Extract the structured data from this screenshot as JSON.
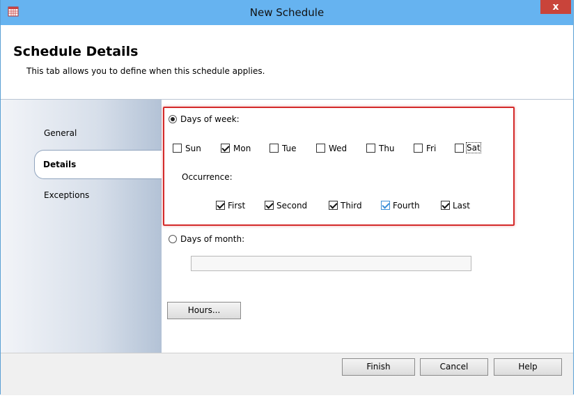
{
  "window": {
    "title": "New Schedule",
    "close_label": "x"
  },
  "header": {
    "title": "Schedule Details",
    "description": "This tab allows you to define when this schedule applies."
  },
  "nav": {
    "items": [
      {
        "label": "General",
        "selected": false
      },
      {
        "label": "Details",
        "selected": true
      },
      {
        "label": "Exceptions",
        "selected": false
      }
    ]
  },
  "details": {
    "days_of_week": {
      "label": "Days of week:",
      "selected": true,
      "days": [
        {
          "label": "Sun",
          "checked": false
        },
        {
          "label": "Mon",
          "checked": true
        },
        {
          "label": "Tue",
          "checked": false
        },
        {
          "label": "Wed",
          "checked": false
        },
        {
          "label": "Thu",
          "checked": false
        },
        {
          "label": "Fri",
          "checked": false
        },
        {
          "label": "Sat",
          "checked": false
        }
      ]
    },
    "occurrence": {
      "label": "Occurrence:",
      "options": [
        {
          "label": "First",
          "checked": true
        },
        {
          "label": "Second",
          "checked": true
        },
        {
          "label": "Third",
          "checked": true
        },
        {
          "label": "Fourth",
          "checked": true
        },
        {
          "label": "Last",
          "checked": true
        }
      ]
    },
    "days_of_month": {
      "label": "Days of month:",
      "selected": false,
      "value": ""
    },
    "hours_button": "Hours..."
  },
  "footer": {
    "finish": "Finish",
    "cancel": "Cancel",
    "help": "Help"
  },
  "colors": {
    "titlebar": "#66b3f0",
    "highlight_box": "#d42a2a",
    "close_button": "#c9443a"
  }
}
